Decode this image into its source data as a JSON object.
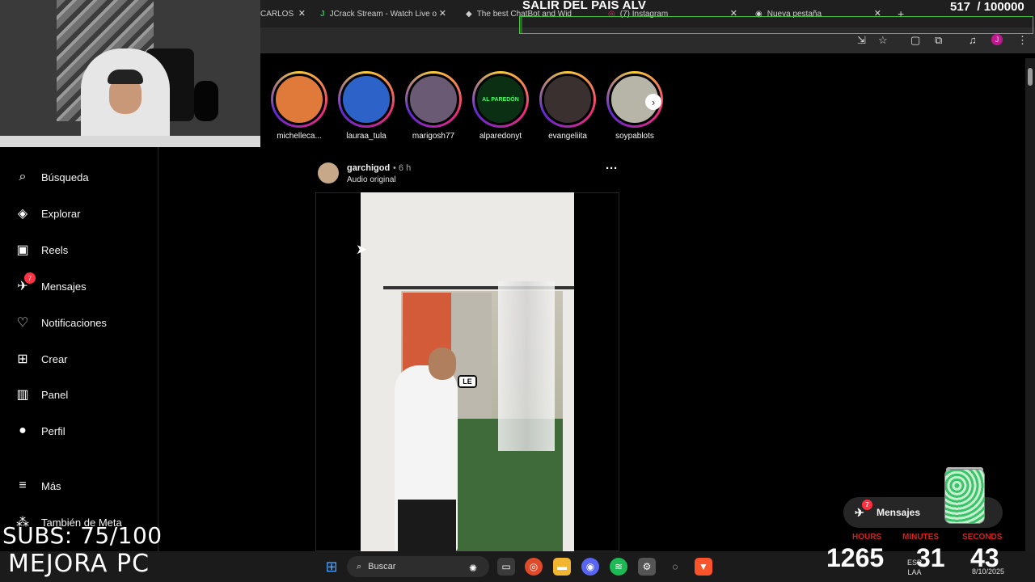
{
  "browser": {
    "tabs": [
      {
        "label": "CARLOS",
        "icon": "",
        "left": 0
      },
      {
        "label": "JCrack Stream - Watch Live o",
        "icon": "J"
      },
      {
        "label": "The best ChatBot and Wid",
        "icon": "◆"
      },
      {
        "label": "(7) Instagram",
        "icon": "◎"
      },
      {
        "label": "Nueva pestaña",
        "icon": "◉"
      }
    ],
    "new_tab": "+"
  },
  "overlay": {
    "title": "SALIR DEL PAIS ALV",
    "count": "517",
    "goal": "/ 100000",
    "progress": 0.005,
    "accent": "#49c242"
  },
  "sidebar": {
    "items": [
      {
        "label": "Búsqueda",
        "icon": "search-icon",
        "glyph": "⌕"
      },
      {
        "label": "Explorar",
        "icon": "compass-icon",
        "glyph": "◈"
      },
      {
        "label": "Reels",
        "icon": "reels-icon",
        "glyph": "▣"
      },
      {
        "label": "Mensajes",
        "icon": "messenger-icon",
        "glyph": "✈",
        "badge": "7"
      },
      {
        "label": "Notificaciones",
        "icon": "heart-icon",
        "glyph": "♡"
      },
      {
        "label": "Crear",
        "icon": "plus-square-icon",
        "glyph": "⊞"
      },
      {
        "label": "Panel",
        "icon": "chart-icon",
        "glyph": "▥"
      },
      {
        "label": "Perfil",
        "icon": "avatar-icon",
        "glyph": "●"
      },
      {
        "label": "Más",
        "icon": "menu-icon",
        "glyph": "≡"
      },
      {
        "label": "También de Meta",
        "icon": "meta-icon",
        "glyph": "⁂"
      }
    ]
  },
  "stories": [
    {
      "name": "michelleca...",
      "color": "#e07a3a"
    },
    {
      "name": "lauraa_tula",
      "color": "#2d63c8"
    },
    {
      "name": "marigosh77",
      "color": "#6a5a74"
    },
    {
      "name": "alparedonyt",
      "color": "#0b2f12",
      "inner_text": "AL PAREDÓN"
    },
    {
      "name": "evangeliita",
      "color": "#3a3030"
    },
    {
      "name": "soypablots",
      "color": "#b7b4a8"
    }
  ],
  "post": {
    "username": "garchigod",
    "time": "• 6 h",
    "audio": "Audio original",
    "more": "···",
    "caption_overlay": "LE"
  },
  "messages_pill": {
    "label": "Mensajes",
    "badge": "7"
  },
  "stream": {
    "subs": "SUBS: 75/100",
    "mejora": "MEJORA PC",
    "timer": {
      "labels": [
        "HOURS",
        "MINUTES",
        "SECONDS"
      ],
      "values": [
        "1265",
        "31",
        "43"
      ]
    }
  },
  "taskbar": {
    "search": "Buscar",
    "lang": "ESP",
    "lang_sub": "LAA",
    "date": "8/10/2025"
  }
}
